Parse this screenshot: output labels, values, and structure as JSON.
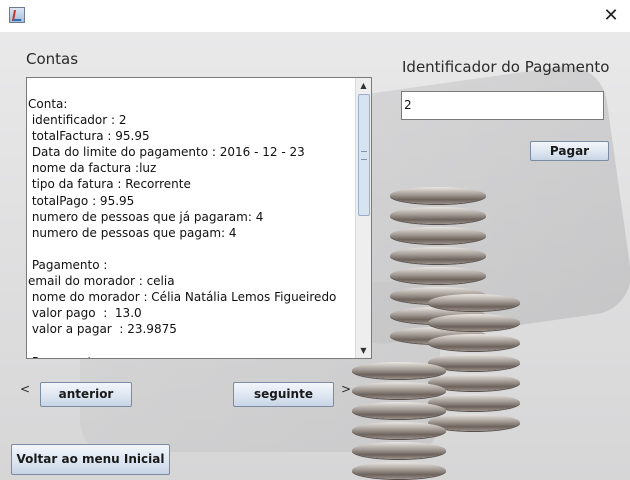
{
  "window": {
    "app_icon": "java-cup-icon",
    "close_glyph": "✕"
  },
  "left_panel": {
    "title": "Contas",
    "text_lines": [
      "Conta:",
      " identificador : 2",
      " totalFactura : 95.95",
      " Data do limite do pagamento : 2016 - 12 - 23",
      " nome da factura :luz",
      " tipo da fatura : Recorrente",
      " totalPago : 95.95",
      " numero de pessoas que já pagaram: 4",
      " numero de pessoas que pagam: 4",
      "",
      " Pagamento :",
      "email do morador : celia",
      " nome do morador : Célia Natália Lemos Figueiredo",
      " valor pago  :  13.0",
      " valor a pagar  : 23.9875",
      "",
      " Pagamento :"
    ],
    "scroll_up_glyph": "▲",
    "scroll_down_glyph": "▼"
  },
  "right_panel": {
    "title": "Identificador do Pagamento",
    "id_value": "2",
    "pay_button": "Pagar"
  },
  "navigation": {
    "prev_symbol": "<",
    "prev_button": "anterior",
    "next_button": "seguinte",
    "next_symbol": ">"
  },
  "footer": {
    "back_button": "Voltar ao menu Inicial"
  }
}
